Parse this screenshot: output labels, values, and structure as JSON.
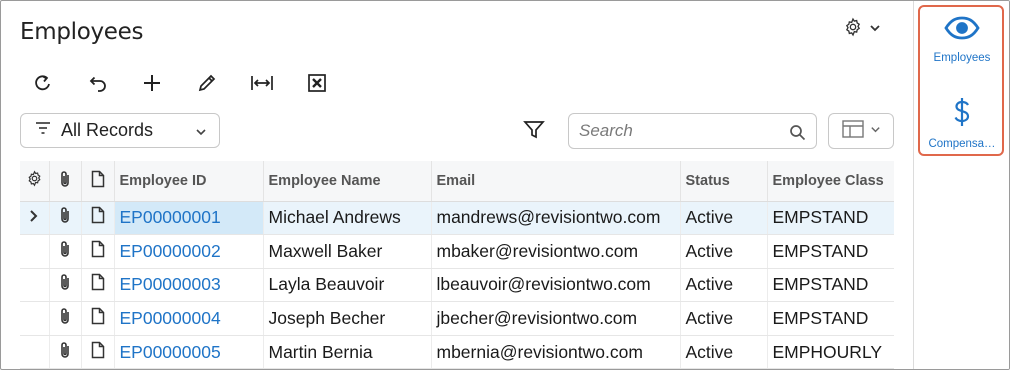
{
  "page": {
    "title": "Employees"
  },
  "toolbar": {
    "buttons": [
      {
        "icon": "refresh-icon"
      },
      {
        "icon": "undo-icon"
      },
      {
        "icon": "add-icon"
      },
      {
        "icon": "edit-icon"
      },
      {
        "icon": "fit-columns-icon"
      },
      {
        "icon": "export-excel-icon"
      }
    ]
  },
  "filter": {
    "selected": "All Records"
  },
  "search": {
    "placeholder": "Search"
  },
  "table": {
    "columns": [
      "Employee ID",
      "Employee Name",
      "Email",
      "Status",
      "Employee Class"
    ],
    "rows": [
      {
        "id": "EP00000001",
        "name": "Michael Andrews",
        "email": "mandrews@revisiontwo.com",
        "status": "Active",
        "class": "EMPSTAND"
      },
      {
        "id": "EP00000002",
        "name": "Maxwell Baker",
        "email": "mbaker@revisiontwo.com",
        "status": "Active",
        "class": "EMPSTAND"
      },
      {
        "id": "EP00000003",
        "name": "Layla Beauvoir",
        "email": "lbeauvoir@revisiontwo.com",
        "status": "Active",
        "class": "EMPSTAND"
      },
      {
        "id": "EP00000004",
        "name": "Joseph Becher",
        "email": "jbecher@revisiontwo.com",
        "status": "Active",
        "class": "EMPSTAND"
      },
      {
        "id": "EP00000005",
        "name": "Martin Bernia",
        "email": "mbernia@revisiontwo.com",
        "status": "Active",
        "class": "EMPHOURLY"
      }
    ]
  },
  "rightbar": {
    "items": [
      {
        "label": "Employees",
        "icon": "eye-icon"
      },
      {
        "label": "Compensa…",
        "icon": "dollar-icon"
      }
    ]
  },
  "colors": {
    "accent": "#1f74c7",
    "highlight": "#e0684b",
    "selected_row": "#eaf4fb"
  }
}
